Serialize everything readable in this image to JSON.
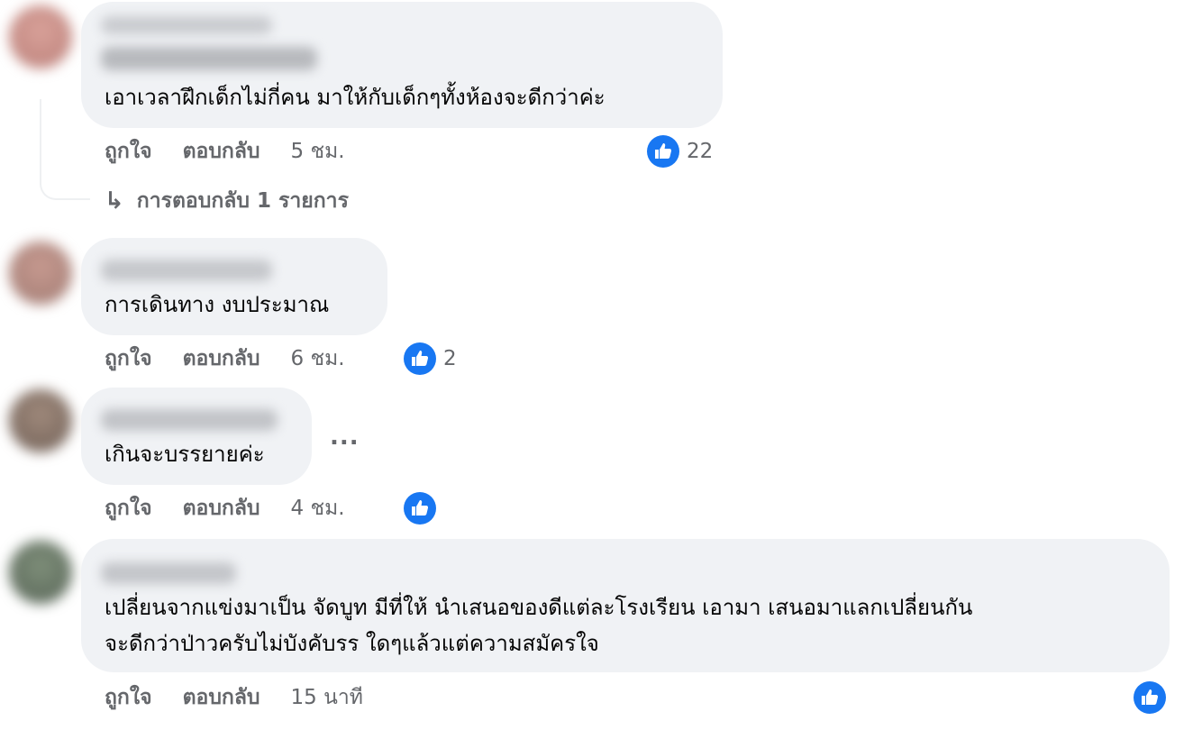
{
  "comments": [
    {
      "text_lines": [
        "เอาเวลาฝึกเด็กไม่กี่คน มาให้กับเด็กๆทั้งห้องจะดีกว่าค่ะ"
      ],
      "actions": {
        "like": "ถูกใจ",
        "reply": "ตอบกลับ",
        "time": "5 ชม."
      },
      "like_count": "22",
      "replies_link": "การตอบกลับ 1 รายการ"
    },
    {
      "text_lines": [
        "การเดินทาง งบประมาณ"
      ],
      "actions": {
        "like": "ถูกใจ",
        "reply": "ตอบกลับ",
        "time": "6 ชม."
      },
      "like_count": "2"
    },
    {
      "text_lines": [
        "เกินจะบรรยายค่ะ"
      ],
      "actions": {
        "like": "ถูกใจ",
        "reply": "ตอบกลับ",
        "time": "4 ชม."
      },
      "like_count": "",
      "more_options": "..."
    },
    {
      "text_lines": [
        "เปลี่ยนจากแข่งมาเป็น จัดบูท มีที่ให้ นำเสนอของดีแต่ละโรงเรียน เอามา เสนอมาแลกเปลี่ยนกัน",
        "จะดีกว่าป่าวครับไม่บังคับรร ใดๆแล้วแต่ความสมัครใจ"
      ],
      "actions": {
        "like": "ถูกใจ",
        "reply": "ตอบกลับ",
        "time": "15 นาที"
      },
      "like_count": ""
    }
  ],
  "colors": {
    "bubble_bg": "#f0f2f5",
    "like_blue": "#1877f2",
    "secondary_text": "#65676b",
    "primary_text": "#050505"
  },
  "icons": {
    "like_badge": "thumbs-up-icon",
    "replies_arrow": "reply-arrow-icon",
    "more": "ellipsis-icon"
  }
}
